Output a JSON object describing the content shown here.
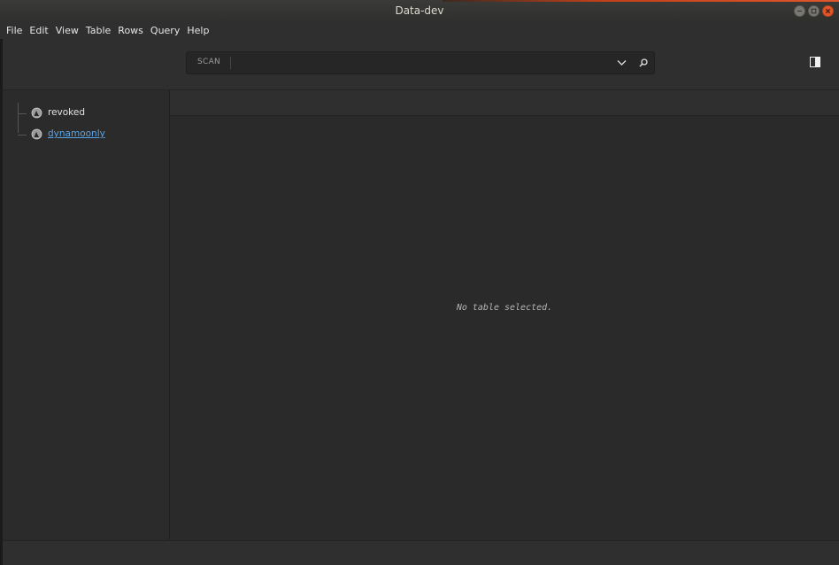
{
  "window": {
    "title": "Data-dev"
  },
  "menubar": {
    "items": [
      "File",
      "Edit",
      "View",
      "Table",
      "Rows",
      "Query",
      "Help"
    ]
  },
  "toolbar": {
    "query_mode": "SCAN",
    "query_value": "",
    "icons": [
      "chevron-down-icon",
      "search-icon",
      "panel-toggle-icon"
    ]
  },
  "sidebar": {
    "databases": [
      {
        "label": "revoked",
        "icon": "database-icon"
      },
      {
        "label": "dynamoonly",
        "icon": "database-icon",
        "selected": true
      }
    ]
  },
  "main": {
    "empty_message": "No table selected."
  },
  "colors": {
    "accent_close": "#e0562a",
    "link": "#5aa4e6",
    "background": "#2a2a2a"
  }
}
